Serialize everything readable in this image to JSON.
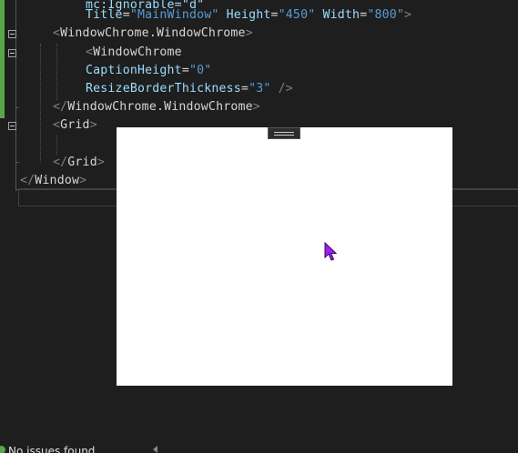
{
  "editor": {
    "lines": [
      [
        {
          "t": "mc:Ignorable=\"d\"",
          "c": "attr"
        }
      ],
      [
        {
          "t": "Title",
          "c": "attr"
        },
        {
          "t": "=",
          "c": "eq"
        },
        {
          "t": "\"MainWindow\"",
          "c": "val"
        },
        {
          "t": " ",
          "c": "eq"
        },
        {
          "t": "Height",
          "c": "attr"
        },
        {
          "t": "=",
          "c": "eq"
        },
        {
          "t": "\"450\"",
          "c": "val"
        },
        {
          "t": " ",
          "c": "eq"
        },
        {
          "t": "Width",
          "c": "attr"
        },
        {
          "t": "=",
          "c": "eq"
        },
        {
          "t": "\"800\"",
          "c": "val"
        },
        {
          "t": ">",
          "c": "punct"
        }
      ],
      [
        {
          "t": "<",
          "c": "punct"
        },
        {
          "t": "WindowChrome.WindowChrome",
          "c": "tag"
        },
        {
          "t": ">",
          "c": "punct"
        }
      ],
      [
        {
          "t": "<",
          "c": "punct"
        },
        {
          "t": "WindowChrome",
          "c": "tag"
        }
      ],
      [
        {
          "t": "CaptionHeight",
          "c": "attr"
        },
        {
          "t": "=",
          "c": "eq"
        },
        {
          "t": "\"0\"",
          "c": "val"
        }
      ],
      [
        {
          "t": "ResizeBorderThickness",
          "c": "attr"
        },
        {
          "t": "=",
          "c": "eq"
        },
        {
          "t": "\"3\"",
          "c": "val"
        },
        {
          "t": " />",
          "c": "punct"
        }
      ],
      [
        {
          "t": "</",
          "c": "punct"
        },
        {
          "t": "WindowChrome.WindowChrome",
          "c": "tag"
        },
        {
          "t": ">",
          "c": "punct"
        }
      ],
      [
        {
          "t": "<",
          "c": "punct"
        },
        {
          "t": "Grid",
          "c": "tag"
        },
        {
          "t": ">",
          "c": "punct"
        }
      ],
      [],
      [
        {
          "t": "</",
          "c": "punct"
        },
        {
          "t": "Grid",
          "c": "tag"
        },
        {
          "t": ">",
          "c": "punct"
        }
      ],
      [
        {
          "t": "</",
          "c": "punct"
        },
        {
          "t": "Window",
          "c": "tag"
        },
        {
          "t": ">",
          "c": "punct"
        }
      ]
    ]
  },
  "status": {
    "message": "No issues found"
  },
  "icons": {
    "status": "check-circle-icon",
    "fold": "fold-collapse-icon",
    "cursor": "mouse-pointer-icon",
    "drag_handle": "drag-handle-icon"
  },
  "colors": {
    "background": "#1e1e1e",
    "tag": "#d6d6d6",
    "attribute": "#9cdcfe",
    "value": "#569cd6",
    "punctuation": "#808080",
    "change_bar": "#57a64a",
    "cursor": "#a020f0"
  }
}
